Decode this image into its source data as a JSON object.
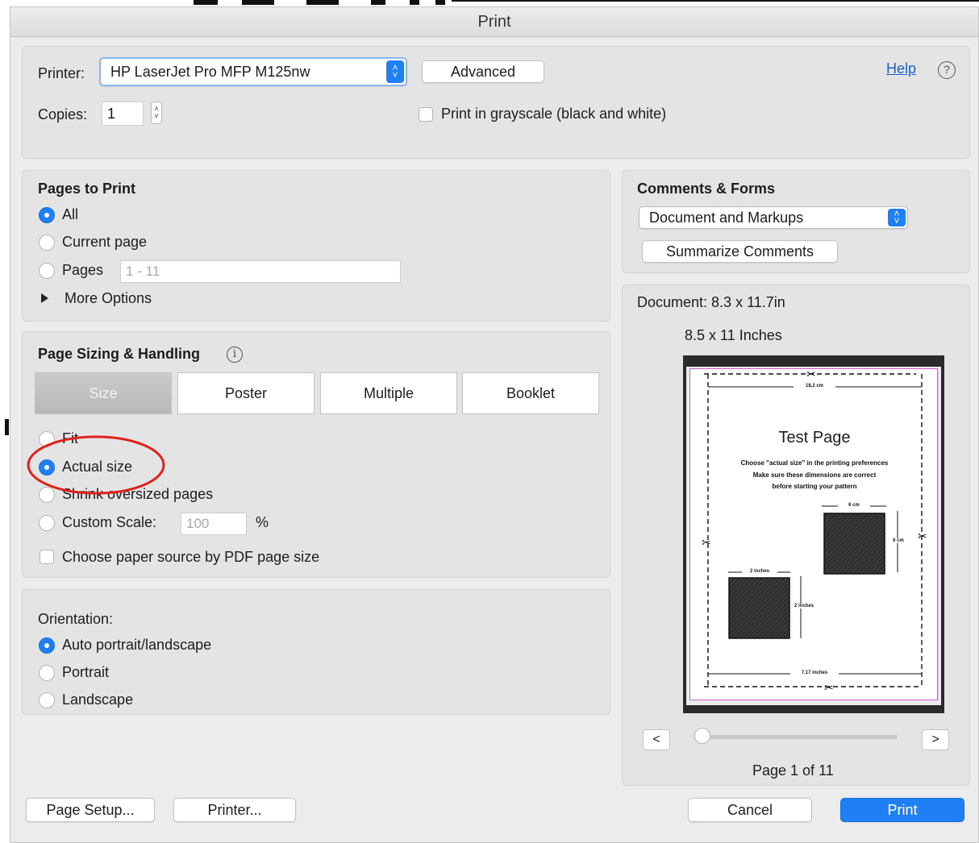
{
  "window": {
    "title": "Print"
  },
  "printer": {
    "label": "Printer:",
    "selected": "HP LaserJet Pro MFP M125nw",
    "advanced_label": "Advanced",
    "help_label": "Help",
    "copies_label": "Copies:",
    "copies_value": "1",
    "grayscale_label": "Print in grayscale (black and white)",
    "grayscale_checked": false
  },
  "pages_to_print": {
    "title": "Pages to Print",
    "options": [
      {
        "label": "All",
        "selected": true
      },
      {
        "label": "Current page",
        "selected": false
      },
      {
        "label": "Pages",
        "selected": false
      }
    ],
    "range_placeholder": "1 - 11",
    "more_options_label": "More Options"
  },
  "page_sizing": {
    "title": "Page Sizing & Handling",
    "tabs": [
      {
        "label": "Size",
        "active": true
      },
      {
        "label": "Poster",
        "active": false
      },
      {
        "label": "Multiple",
        "active": false
      },
      {
        "label": "Booklet",
        "active": false
      }
    ],
    "options": [
      {
        "label": "Fit",
        "selected": false
      },
      {
        "label": "Actual size",
        "selected": true
      },
      {
        "label": "Shrink oversized pages",
        "selected": false
      },
      {
        "label": "Custom Scale:",
        "selected": false
      }
    ],
    "scale_placeholder": "100",
    "scale_unit": "%",
    "paper_source_label": "Choose paper source by PDF page size",
    "paper_source_checked": false,
    "annotation_color": "#e0201a"
  },
  "orientation": {
    "title": "Orientation:",
    "options": [
      {
        "label": "Auto portrait/landscape",
        "selected": true
      },
      {
        "label": "Portrait",
        "selected": false
      },
      {
        "label": "Landscape",
        "selected": false
      }
    ]
  },
  "comments_forms": {
    "title": "Comments & Forms",
    "selected": "Document and Markups",
    "summarize_label": "Summarize Comments"
  },
  "preview": {
    "document_size": "Document: 8.3 x 11.7in",
    "paper_size": "8.5 x 11 Inches",
    "page_title": "Test Page",
    "page_lines": [
      "Choose \"actual size\" in the printing preferences",
      "Make sure these dimensions are correct",
      "before starting your pattern"
    ],
    "dim_top": "18,2 cm",
    "dim_bottom": "7,17 inches",
    "dim_square_cm_w": "6 cm",
    "dim_square_cm_h": "6 cm",
    "dim_square_in_w": "2 inches",
    "dim_square_in_h": "2 inches",
    "prev_label": "<",
    "next_label": ">",
    "page_indicator": "Page 1 of 11",
    "slider_position": 0
  },
  "footer": {
    "page_setup_label": "Page Setup...",
    "printer_label": "Printer...",
    "cancel_label": "Cancel",
    "print_label": "Print"
  },
  "colors": {
    "accent": "#1f7ff4",
    "link": "#1a5ed8"
  }
}
